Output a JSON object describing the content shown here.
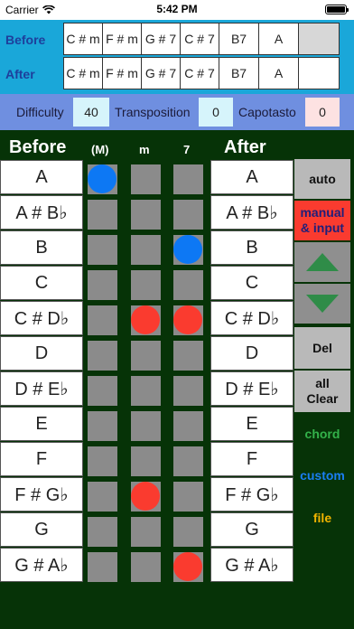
{
  "status": {
    "carrier": "Carrier",
    "time": "5:42 PM"
  },
  "before_row": {
    "label": "Before",
    "cells": [
      "C # m",
      "F # m",
      "G # 7",
      "C # 7",
      "B7",
      "A",
      ""
    ]
  },
  "after_row": {
    "label": "After",
    "cells": [
      "C # m",
      "F # m",
      "G # 7",
      "C # 7",
      "B7",
      "A",
      ""
    ]
  },
  "settings": {
    "difficulty_label": "Difficulty",
    "difficulty_value": "40",
    "transposition_label": "Transposition",
    "transposition_value": "0",
    "capotasto_label": "Capotasto",
    "capotasto_value": "0"
  },
  "main": {
    "before_heading": "Before",
    "after_heading": "After",
    "col_major": "(M)",
    "col_minor": "m",
    "col_seventh": "7"
  },
  "notes_before": [
    "A",
    "A # B♭",
    "B",
    "C",
    "C # D♭",
    "D",
    "D # E♭",
    "E",
    "F",
    "F # G♭",
    "G",
    "G # A♭"
  ],
  "notes_after": [
    "A",
    "A # B♭",
    "B",
    "C",
    "C # D♭",
    "D",
    "D # E♭",
    "E",
    "F",
    "F # G♭",
    "G",
    "G # A♭"
  ],
  "selections": [
    {
      "row": 0,
      "col": 0,
      "color": "blue"
    },
    {
      "row": 2,
      "col": 2,
      "color": "blue"
    },
    {
      "row": 4,
      "col": 1,
      "color": "red"
    },
    {
      "row": 4,
      "col": 2,
      "color": "red"
    },
    {
      "row": 9,
      "col": 1,
      "color": "red"
    },
    {
      "row": 11,
      "col": 2,
      "color": "red"
    }
  ],
  "side": {
    "auto": "auto",
    "manual": "manual & input",
    "del": "Del",
    "all_clear": "all Clear",
    "chord": "chord",
    "custom": "custom",
    "file": "file",
    "up_icon": "arrow-up-icon",
    "down_icon": "arrow-down-icon"
  },
  "colors": {
    "header_bg": "#1aa7d9",
    "settings_bg": "#6f8fe0",
    "main_bg": "#063307",
    "blue_dot": "#0d78f4",
    "red_dot": "#fa3b2f",
    "chord": "#33b24a",
    "custom": "#1a7ef2",
    "file": "#f0b400"
  }
}
